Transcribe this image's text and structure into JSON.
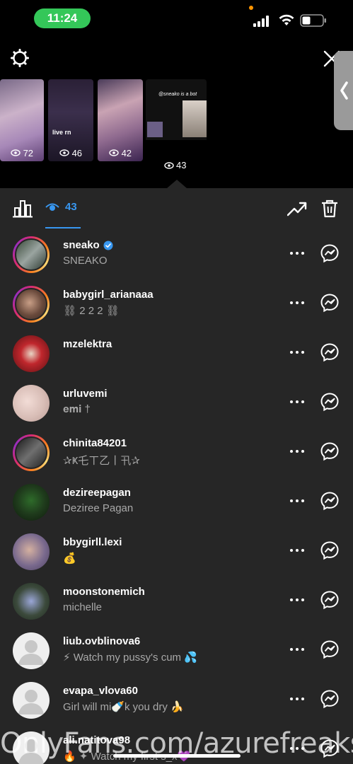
{
  "status_bar": {
    "time": "11:24"
  },
  "story_thumbs": [
    {
      "views": "72"
    },
    {
      "views": "46",
      "overlay_text": "live rn"
    },
    {
      "views": "42"
    },
    {
      "title": "@sneako is a bot",
      "views": "43"
    }
  ],
  "toolbar": {
    "viewers_count": "43"
  },
  "viewers": [
    {
      "username": "sneako",
      "subtitle": "SNEAKO",
      "verified": true,
      "ring": true
    },
    {
      "username": "babygirl_arianaaa",
      "subtitle": "⛓ 2 2 2 ⛓",
      "verified": false,
      "ring": true
    },
    {
      "username": "mzelektra",
      "subtitle": "",
      "verified": false,
      "ring": false
    },
    {
      "username": "urluvemi",
      "subtitle": "𝐞𝐦𝐢 †",
      "verified": false,
      "ring": false
    },
    {
      "username": "chinita84201",
      "subtitle": "✰Ҝ乇ㄒ乙丨卂✰",
      "verified": false,
      "ring": true
    },
    {
      "username": "dezireepagan",
      "subtitle": "Deziree Pagan",
      "verified": false,
      "ring": false
    },
    {
      "username": "bbygirll.lexi",
      "subtitle": "💰",
      "verified": false,
      "ring": false
    },
    {
      "username": "moonstonemich",
      "subtitle": "michelle",
      "verified": false,
      "ring": false
    },
    {
      "username": "liub.ovblinova6",
      "subtitle": "⚡ Watch my pussy's cum 💦",
      "verified": false,
      "ring": false
    },
    {
      "username": "evapa_vlova60",
      "subtitle": "Girl will mi🍼k you dry 🍌",
      "verified": false,
      "ring": false
    },
    {
      "username": "ali.natitova98",
      "subtitle": "🔥 ✦ Watch my first s_x💜",
      "verified": false,
      "ring": false
    }
  ],
  "watermark": "OnlyFans.com/azurefreaks",
  "colors": {
    "accent": "#3897f0",
    "sheet_bg": "#262626",
    "status_pill": "#34c759"
  }
}
